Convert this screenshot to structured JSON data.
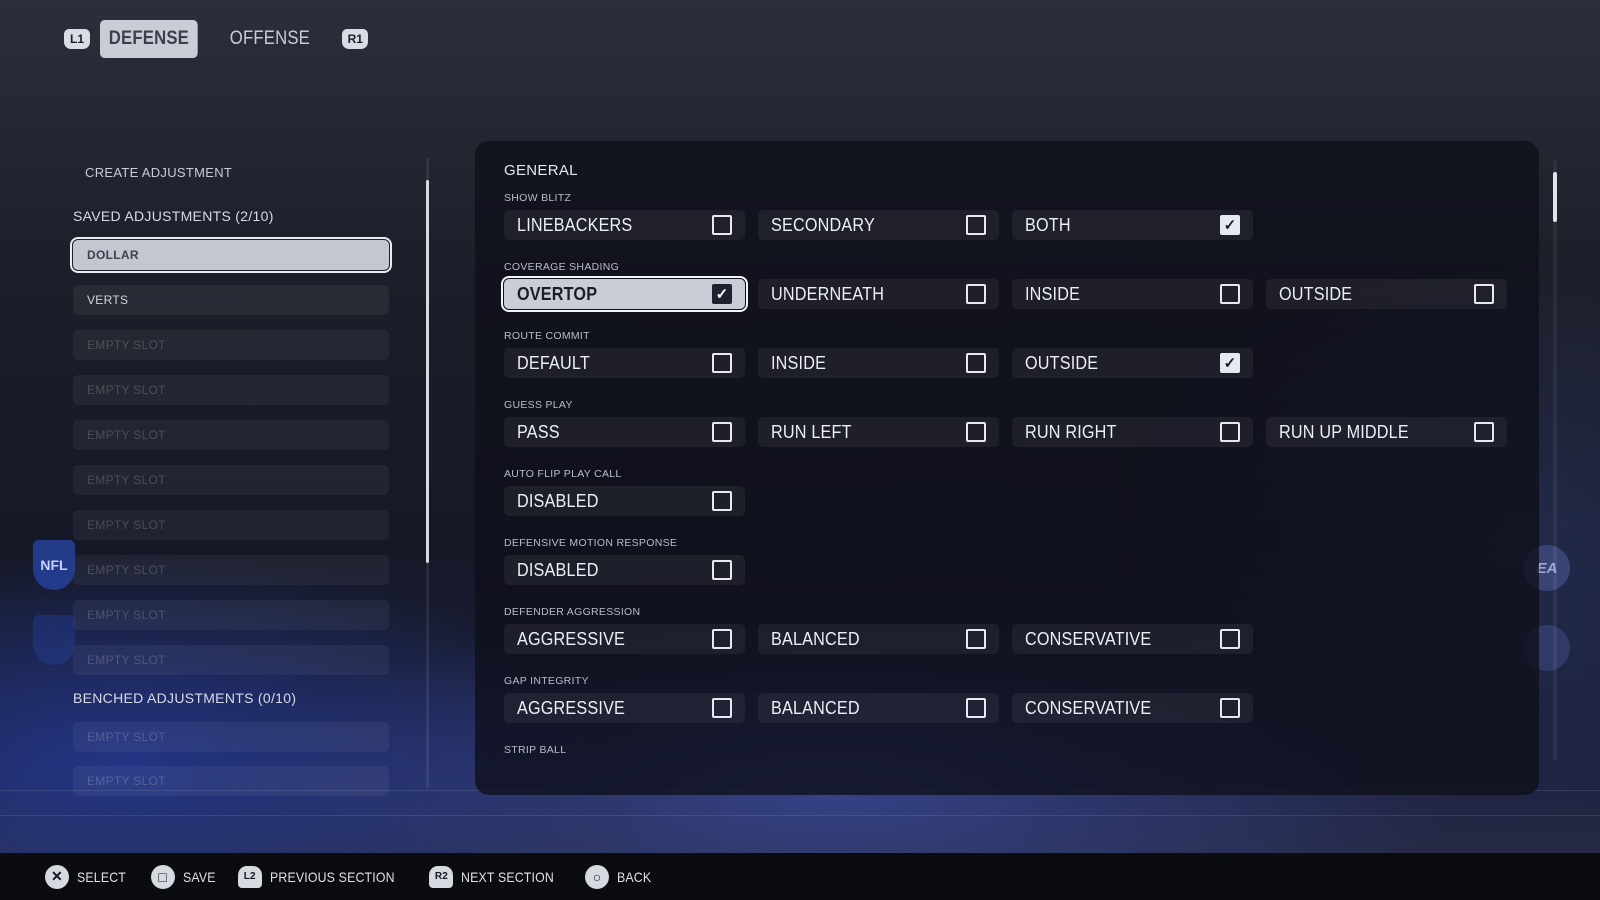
{
  "topbar": {
    "left_bumper": "L1",
    "tabs": [
      {
        "label": "DEFENSE",
        "active": true
      },
      {
        "label": "OFFENSE",
        "active": false
      }
    ],
    "right_bumper": "R1"
  },
  "sidebar": {
    "create_label": "CREATE ADJUSTMENT",
    "saved_heading": "SAVED ADJUSTMENTS (2/10)",
    "saved_slots": [
      "DOLLAR",
      "VERTS",
      "EMPTY SLOT",
      "EMPTY SLOT",
      "EMPTY SLOT",
      "EMPTY SLOT",
      "EMPTY SLOT",
      "EMPTY SLOT",
      "EMPTY SLOT",
      "EMPTY SLOT"
    ],
    "selected_slot": "DOLLAR",
    "benched_heading": "BENCHED ADJUSTMENTS (0/10)",
    "benched_slots": [
      "EMPTY SLOT",
      "EMPTY SLOT"
    ]
  },
  "panel": {
    "title": "GENERAL",
    "groups": [
      {
        "label": "SHOW BLITZ",
        "options": [
          {
            "label": "LINEBACKERS",
            "checked": false
          },
          {
            "label": "SECONDARY",
            "checked": false
          },
          {
            "label": "BOTH",
            "checked": true
          }
        ]
      },
      {
        "label": "COVERAGE SHADING",
        "options": [
          {
            "label": "OVERTOP",
            "checked": true,
            "focused": true
          },
          {
            "label": "UNDERNEATH",
            "checked": false
          },
          {
            "label": "INSIDE",
            "checked": false
          },
          {
            "label": "OUTSIDE",
            "checked": false
          }
        ]
      },
      {
        "label": "ROUTE COMMIT",
        "options": [
          {
            "label": "DEFAULT",
            "checked": false
          },
          {
            "label": "INSIDE",
            "checked": false
          },
          {
            "label": "OUTSIDE",
            "checked": true
          }
        ]
      },
      {
        "label": "GUESS PLAY",
        "options": [
          {
            "label": "PASS",
            "checked": false
          },
          {
            "label": "RUN LEFT",
            "checked": false
          },
          {
            "label": "RUN RIGHT",
            "checked": false
          },
          {
            "label": "RUN UP MIDDLE",
            "checked": false
          }
        ]
      },
      {
        "label": "AUTO FLIP PLAY CALL",
        "options": [
          {
            "label": "DISABLED",
            "checked": false
          }
        ]
      },
      {
        "label": "DEFENSIVE MOTION RESPONSE",
        "options": [
          {
            "label": "DISABLED",
            "checked": false
          }
        ]
      },
      {
        "label": "DEFENDER AGGRESSION",
        "options": [
          {
            "label": "AGGRESSIVE",
            "checked": false
          },
          {
            "label": "BALANCED",
            "checked": false
          },
          {
            "label": "CONSERVATIVE",
            "checked": false
          }
        ]
      },
      {
        "label": "GAP INTEGRITY",
        "options": [
          {
            "label": "AGGRESSIVE",
            "checked": false
          },
          {
            "label": "BALANCED",
            "checked": false
          },
          {
            "label": "CONSERVATIVE",
            "checked": false
          }
        ]
      },
      {
        "label": "STRIP BALL",
        "options": []
      }
    ]
  },
  "logos": {
    "left": "NFL",
    "right": "EA"
  },
  "bottombar": {
    "hints": [
      {
        "icon": "cross-button-icon",
        "glyph": "✕",
        "label": "SELECT"
      },
      {
        "icon": "square-button-icon",
        "glyph": "□",
        "label": "SAVE"
      },
      {
        "icon": "l2-trigger-icon",
        "glyph": "L2",
        "label": "PREVIOUS SECTION"
      },
      {
        "icon": "r2-trigger-icon",
        "glyph": "R2",
        "label": "NEXT SECTION"
      },
      {
        "icon": "circle-button-icon",
        "glyph": "○",
        "label": "BACK"
      }
    ]
  },
  "colors": {
    "focus": "#c9cdd6",
    "panel_bg": "#0e101a",
    "text": "#eceff5"
  }
}
